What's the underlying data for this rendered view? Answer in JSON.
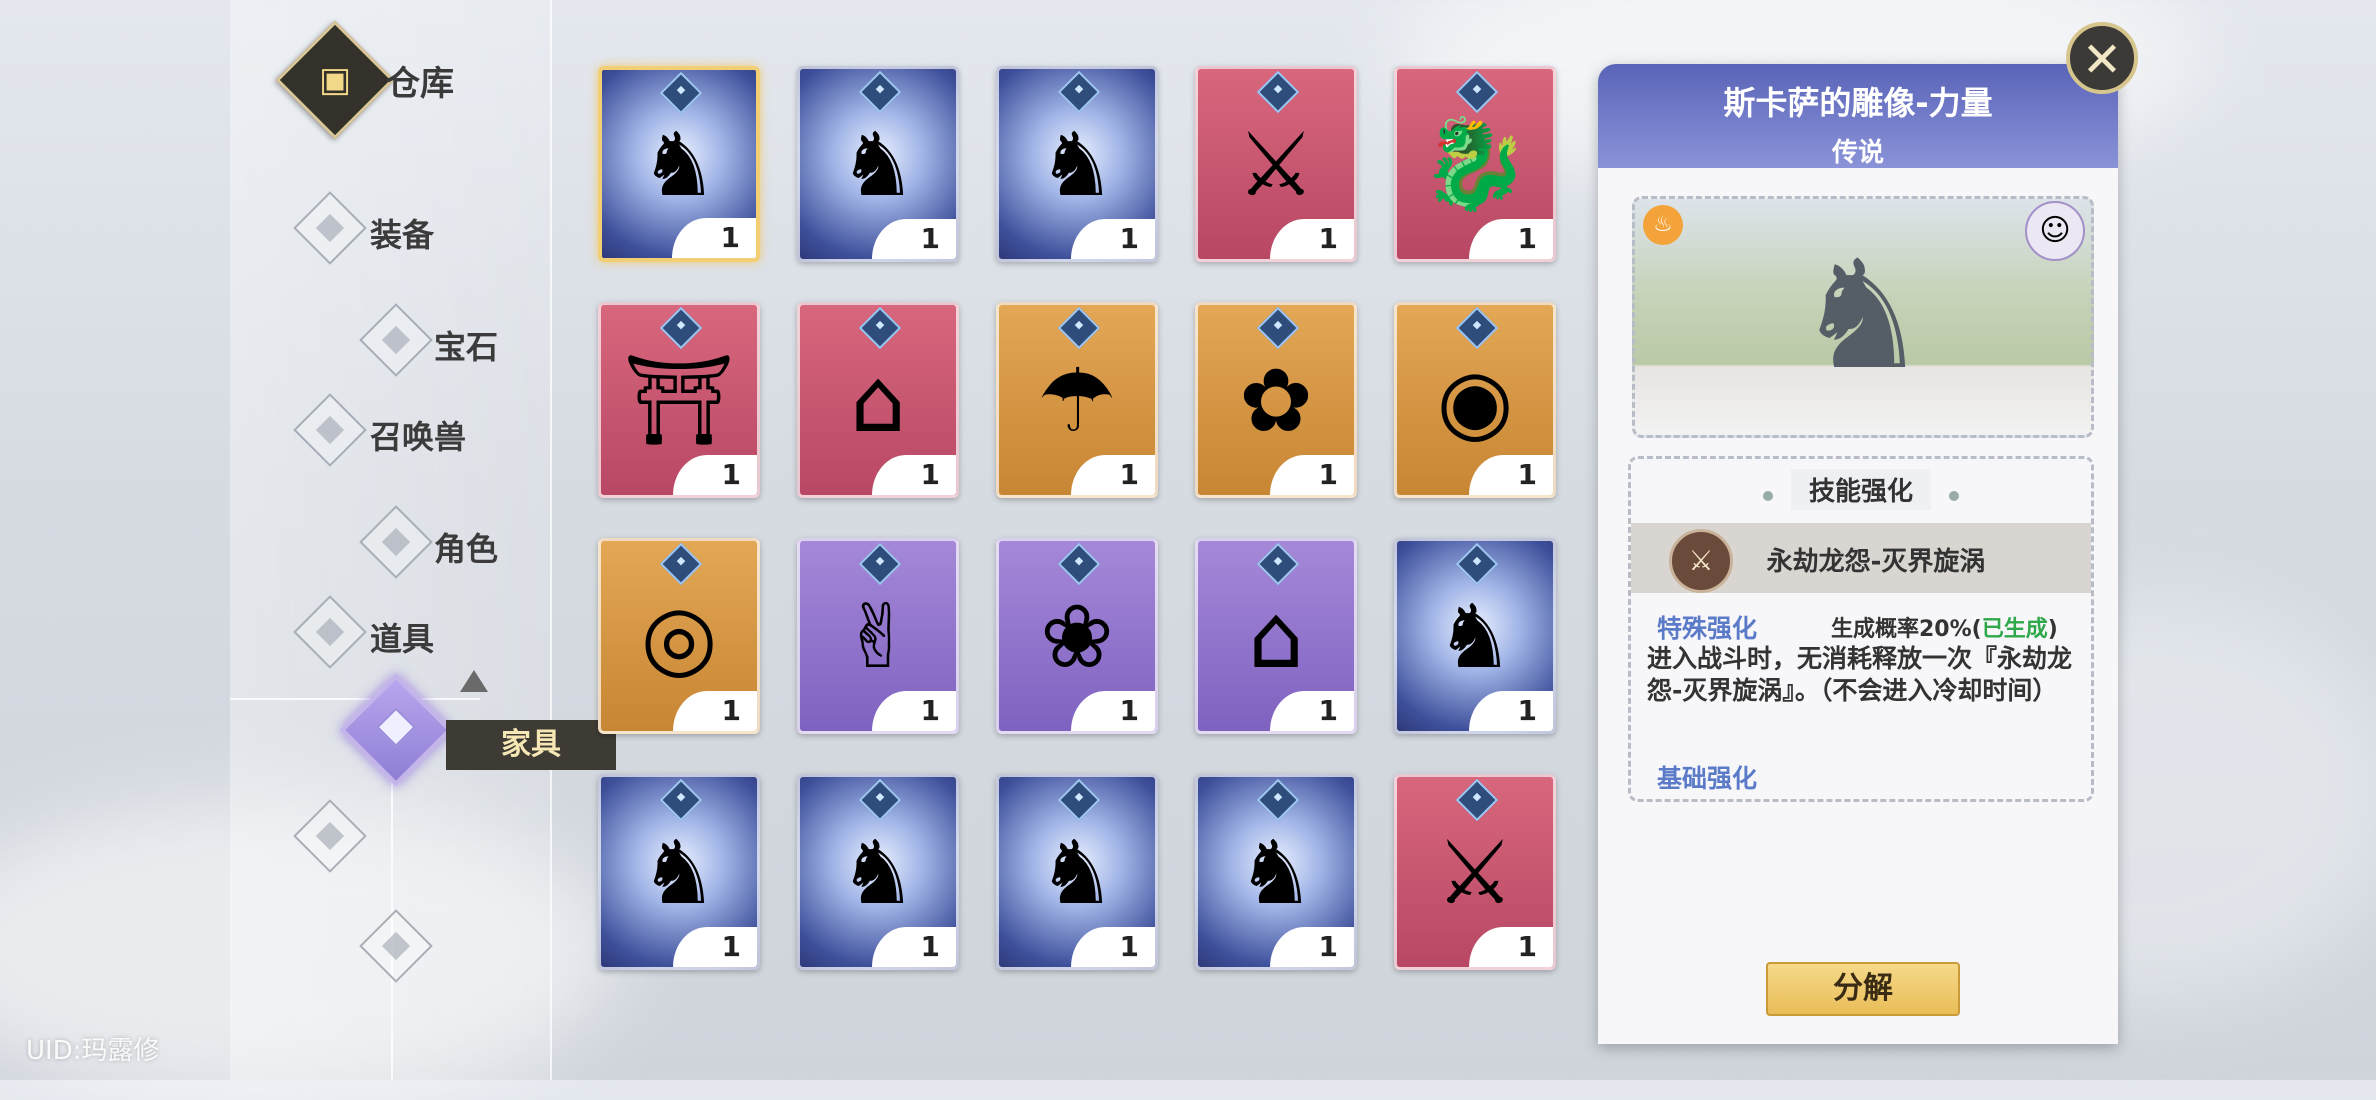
{
  "sidebar": {
    "title": "仓库",
    "items": [
      {
        "label": "装备"
      },
      {
        "label": "宝石"
      },
      {
        "label": "召唤兽"
      },
      {
        "label": "角色"
      },
      {
        "label": "道具"
      }
    ],
    "active_label": "家具"
  },
  "uid_text": "UID:玛露修",
  "items": [
    {
      "quantity": "1",
      "rarity": "blue",
      "icon": "statue-icon",
      "selected": true
    },
    {
      "quantity": "1",
      "rarity": "blue",
      "icon": "statue-icon"
    },
    {
      "quantity": "1",
      "rarity": "blue",
      "icon": "statue-icon"
    },
    {
      "quantity": "1",
      "rarity": "red",
      "icon": "weapon-rack-icon"
    },
    {
      "quantity": "1",
      "rarity": "red",
      "icon": "dragon-vane-icon"
    },
    {
      "quantity": "1",
      "rarity": "red",
      "icon": "dragon-shrine-icon"
    },
    {
      "quantity": "1",
      "rarity": "red",
      "icon": "house-icon"
    },
    {
      "quantity": "1",
      "rarity": "gold",
      "icon": "parasol-icon"
    },
    {
      "quantity": "1",
      "rarity": "gold",
      "icon": "flower-bed-icon"
    },
    {
      "quantity": "1",
      "rarity": "gold",
      "icon": "gong-icon"
    },
    {
      "quantity": "1",
      "rarity": "gold",
      "icon": "blue-gong-icon"
    },
    {
      "quantity": "1",
      "rarity": "purple",
      "icon": "hand-sign-icon"
    },
    {
      "quantity": "1",
      "rarity": "purple",
      "icon": "planter-icon"
    },
    {
      "quantity": "1",
      "rarity": "purple",
      "icon": "burger-shop-icon"
    },
    {
      "quantity": "1",
      "rarity": "blue",
      "icon": "statue-icon"
    },
    {
      "quantity": "1",
      "rarity": "blue",
      "icon": "statue-icon"
    },
    {
      "quantity": "1",
      "rarity": "blue",
      "icon": "statue-icon"
    },
    {
      "quantity": "1",
      "rarity": "blue",
      "icon": "statue-icon"
    },
    {
      "quantity": "1",
      "rarity": "blue",
      "icon": "statue-icon"
    },
    {
      "quantity": "1",
      "rarity": "red",
      "icon": "weapon-rack-icon"
    }
  ],
  "detail": {
    "title": "斯卡萨的雕像-力量",
    "rarity": "传说",
    "skill_header": "技能强化",
    "skill_name": "永劫龙怨-灭界旋涡",
    "special_label": "特殊强化",
    "prob_text": "生成概率20%(",
    "prob_status": "已生成",
    "prob_close": ")",
    "description": "进入战斗时，无消耗释放一次『永劫龙怨-灭界旋涡』。（不会进入冷却时间）",
    "base_label": "基础强化",
    "decompose_label": "分解"
  },
  "colors": {
    "legendary_header": "#5a64b8",
    "highlight_green": "#2ea84a",
    "label_blue": "#5b7bc8",
    "button_gold": "#e9bd58"
  }
}
